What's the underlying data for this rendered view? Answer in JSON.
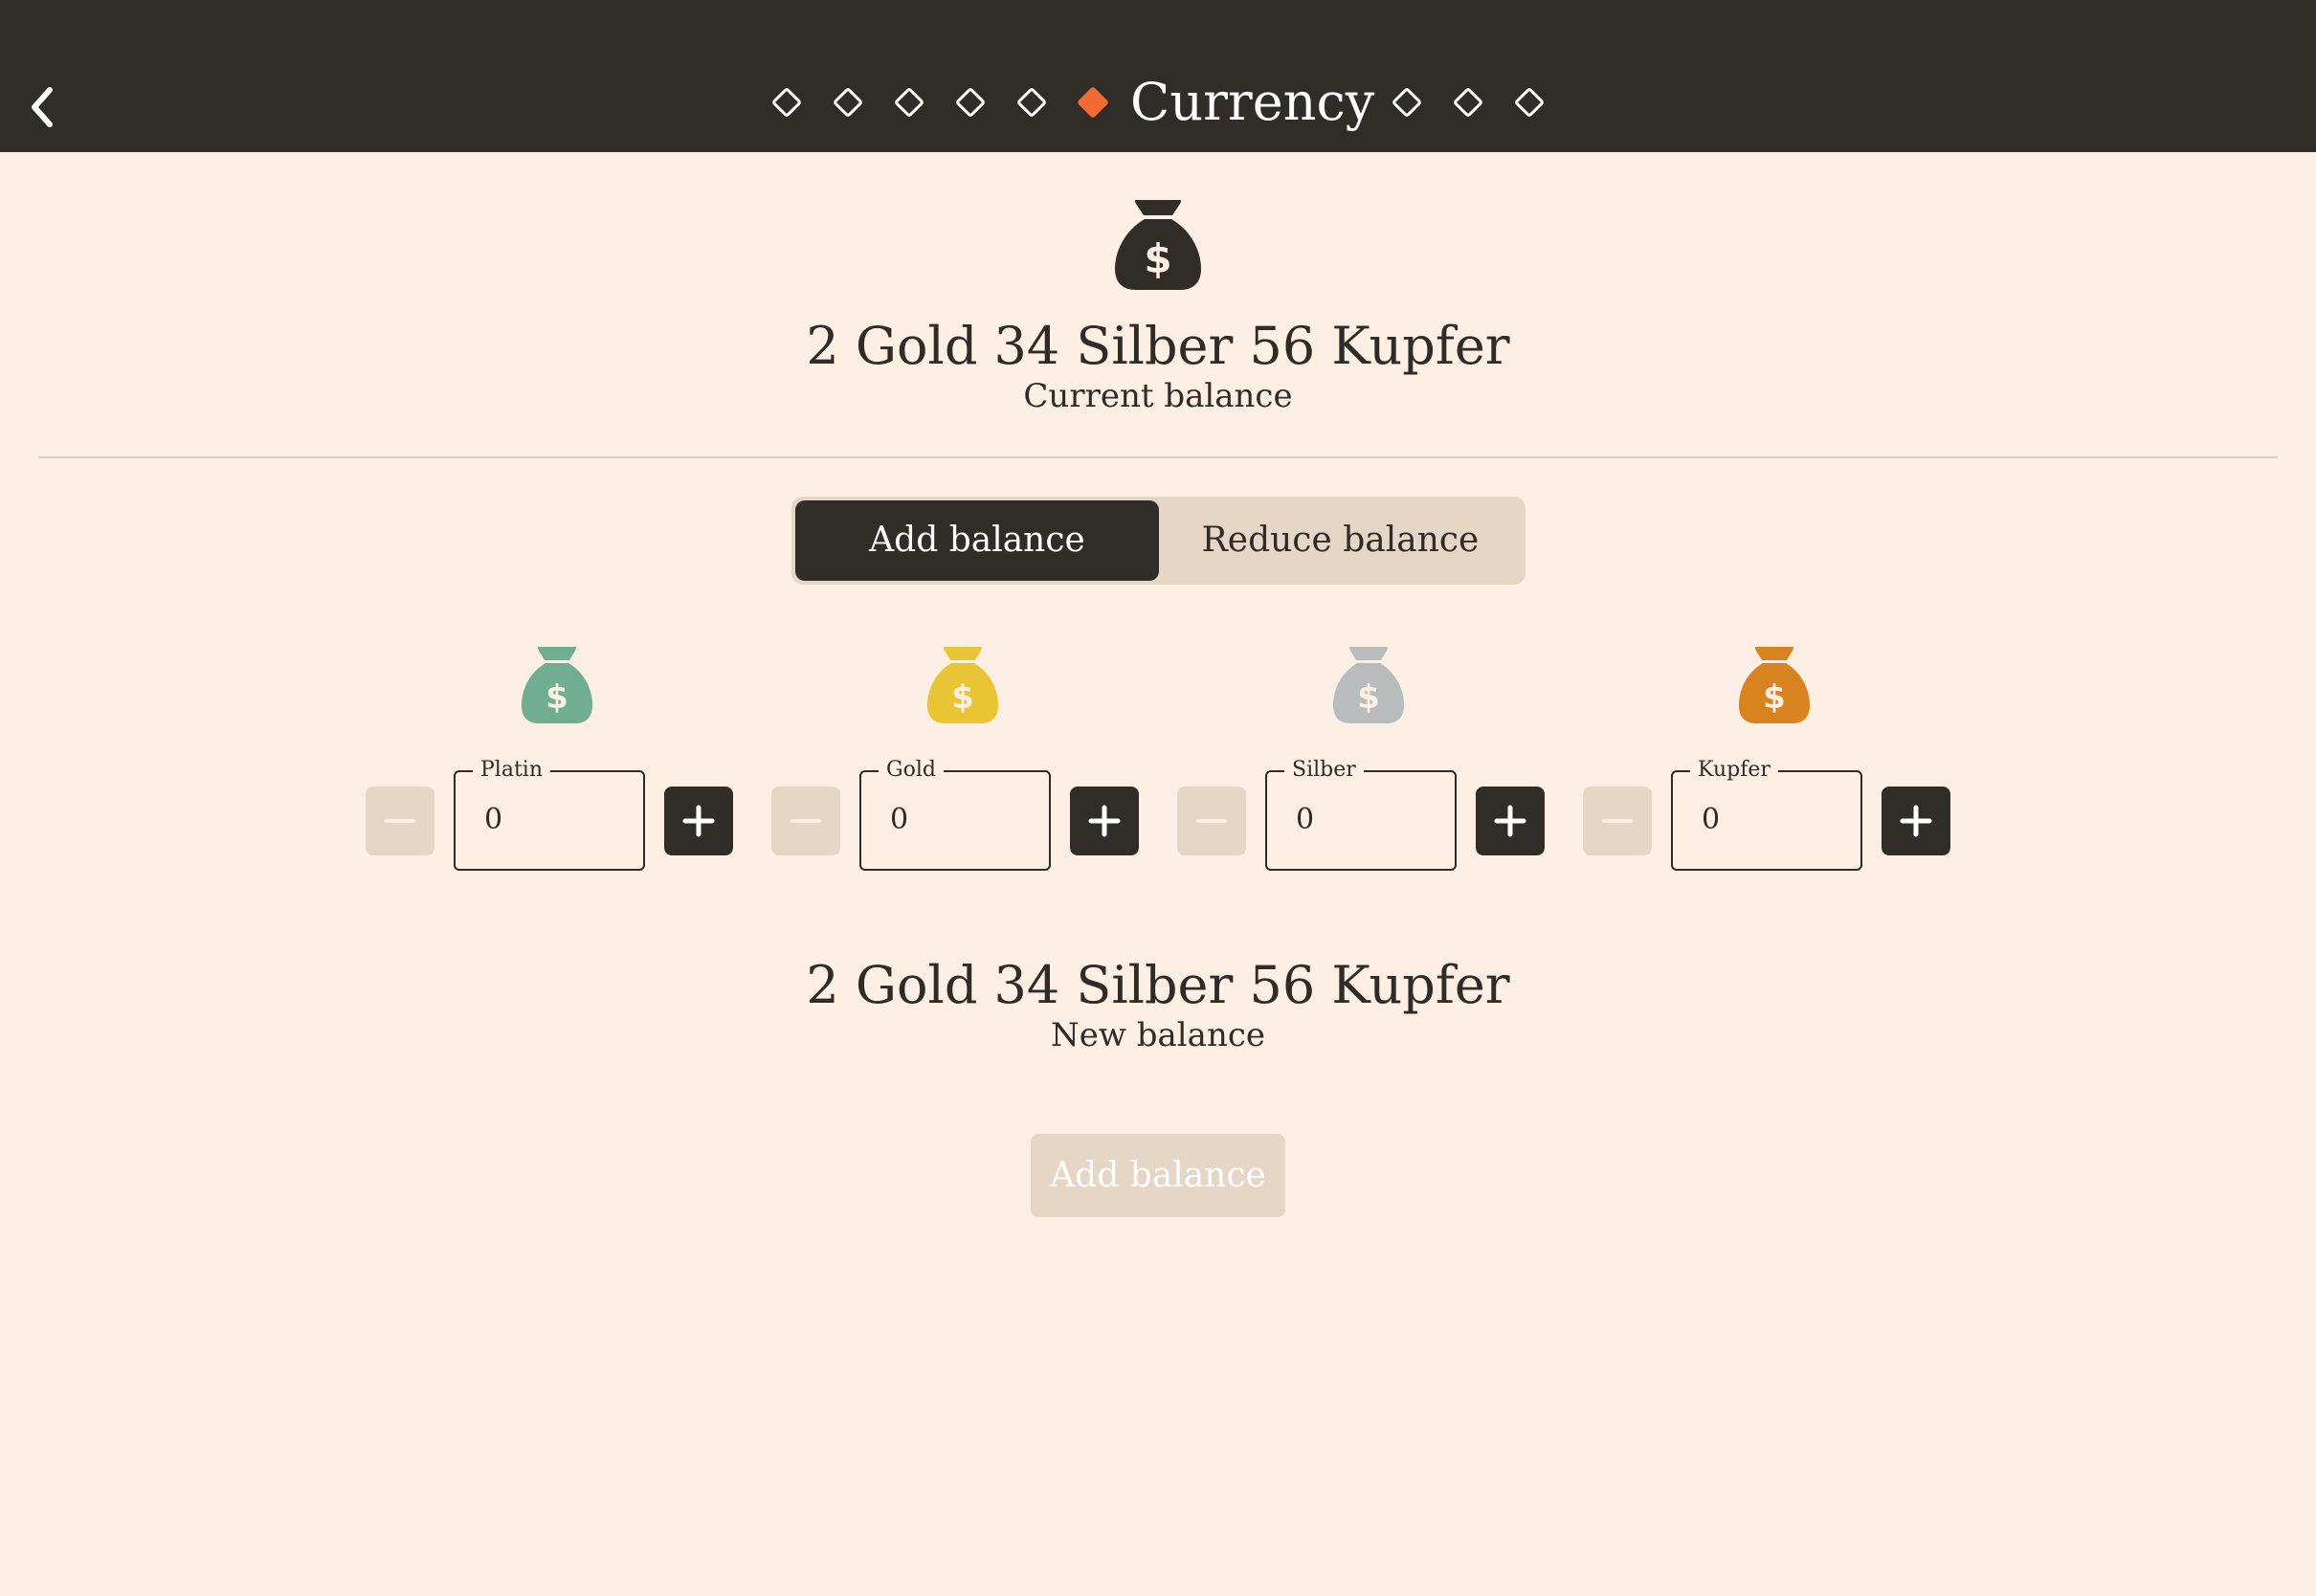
{
  "header": {
    "title": "Currency",
    "active_color": "#f26b35",
    "icons": {
      "back": "chevron-left-icon",
      "step": "diamond-icon"
    }
  },
  "current": {
    "balance": "2 Gold 34 Silber 56 Kupfer",
    "caption": "Current balance",
    "icon": "money-bag-icon"
  },
  "mode": {
    "add_label": "Add balance",
    "reduce_label": "Reduce balance",
    "selected": "Add balance"
  },
  "coins": [
    {
      "label": "Platin",
      "value": "0",
      "color": "#71ad91",
      "icon": "money-bag-icon"
    },
    {
      "label": "Gold",
      "value": "0",
      "color": "#e9c535",
      "icon": "money-bag-icon"
    },
    {
      "label": "Silber",
      "value": "0",
      "color": "#b9bcbc",
      "icon": "money-bag-icon"
    },
    {
      "label": "Kupfer",
      "value": "0",
      "color": "#d78420",
      "icon": "money-bag-icon"
    }
  ],
  "new": {
    "balance": "2 Gold 34 Silber 56 Kupfer",
    "caption": "New balance"
  },
  "submit": {
    "label": "Add balance",
    "disabled": true
  }
}
